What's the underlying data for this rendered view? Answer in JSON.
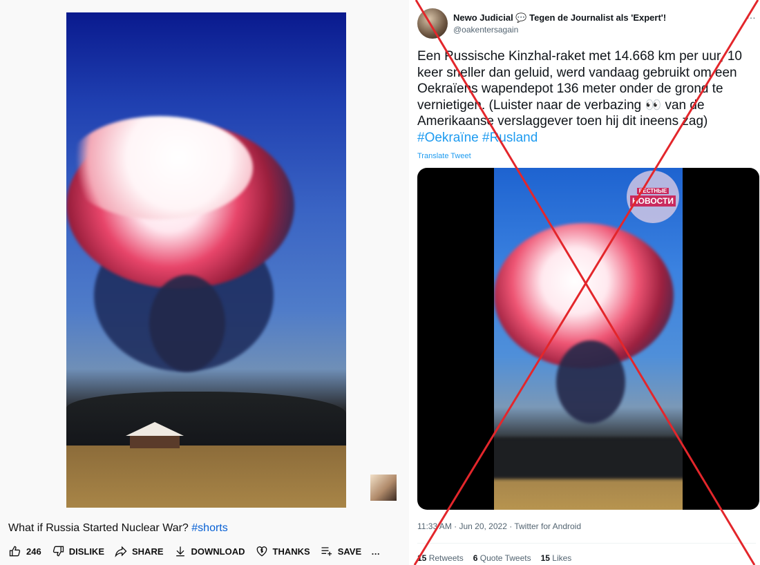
{
  "youtube": {
    "title": "What if Russia Started Nuclear War?",
    "hashtag": "#shorts",
    "actions": {
      "like_count": "246",
      "dislike": "DISLIKE",
      "share": "SHARE",
      "download": "DOWNLOAD",
      "thanks": "THANKS",
      "save": "SAVE",
      "more": "…"
    }
  },
  "tweet": {
    "display_name": "Newo Judicial 💬 Tegen de Journalist als 'Expert'!",
    "handle": "@oakentersagain",
    "more": "…",
    "text": "Een Russische Kinzhal-raket met 14.668 km per uur, 10 keer sneller dan geluid, werd vandaag gebruikt om een Oekraïens wapendepot 136 meter onder de grond te vernietigen.  (Luister naar de verbazing 👀 van de Amerikaanse verslaggever toen hij dit ineens zag)",
    "hashtags": "#Oekraïne #Rusland",
    "translate": "Translate Tweet",
    "media_logo_top": "ВЕСТНЫЕ",
    "media_logo_bottom": "НОВОСТИ",
    "meta": "11:33 AM · Jun 20, 2022 · Twitter for Android",
    "stats": {
      "retweets_count": "15",
      "retweets_label": "Retweets",
      "quotes_count": "6",
      "quotes_label": "Quote Tweets",
      "likes_count": "15",
      "likes_label": "Likes"
    }
  },
  "colors": {
    "link": "#1d9bf0",
    "yt_link": "#065fd4",
    "cross": "#e3262b"
  }
}
